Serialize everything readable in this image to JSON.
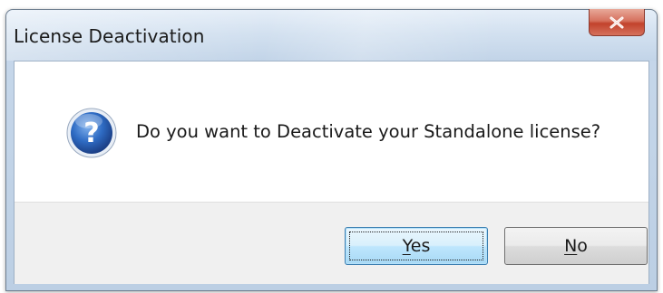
{
  "window": {
    "title": "License Deactivation",
    "close_icon": "close-icon"
  },
  "dialog": {
    "icon": "question-icon",
    "message": "Do you want to Deactivate your Standalone license?"
  },
  "buttons": {
    "yes": {
      "accel": "Y",
      "rest": "es"
    },
    "no": {
      "accel": "N",
      "rest": "o"
    }
  },
  "colors": {
    "close_red": "#c2422c",
    "default_button_blue": "#3c7fb1",
    "icon_blue": "#2a5fb0"
  }
}
